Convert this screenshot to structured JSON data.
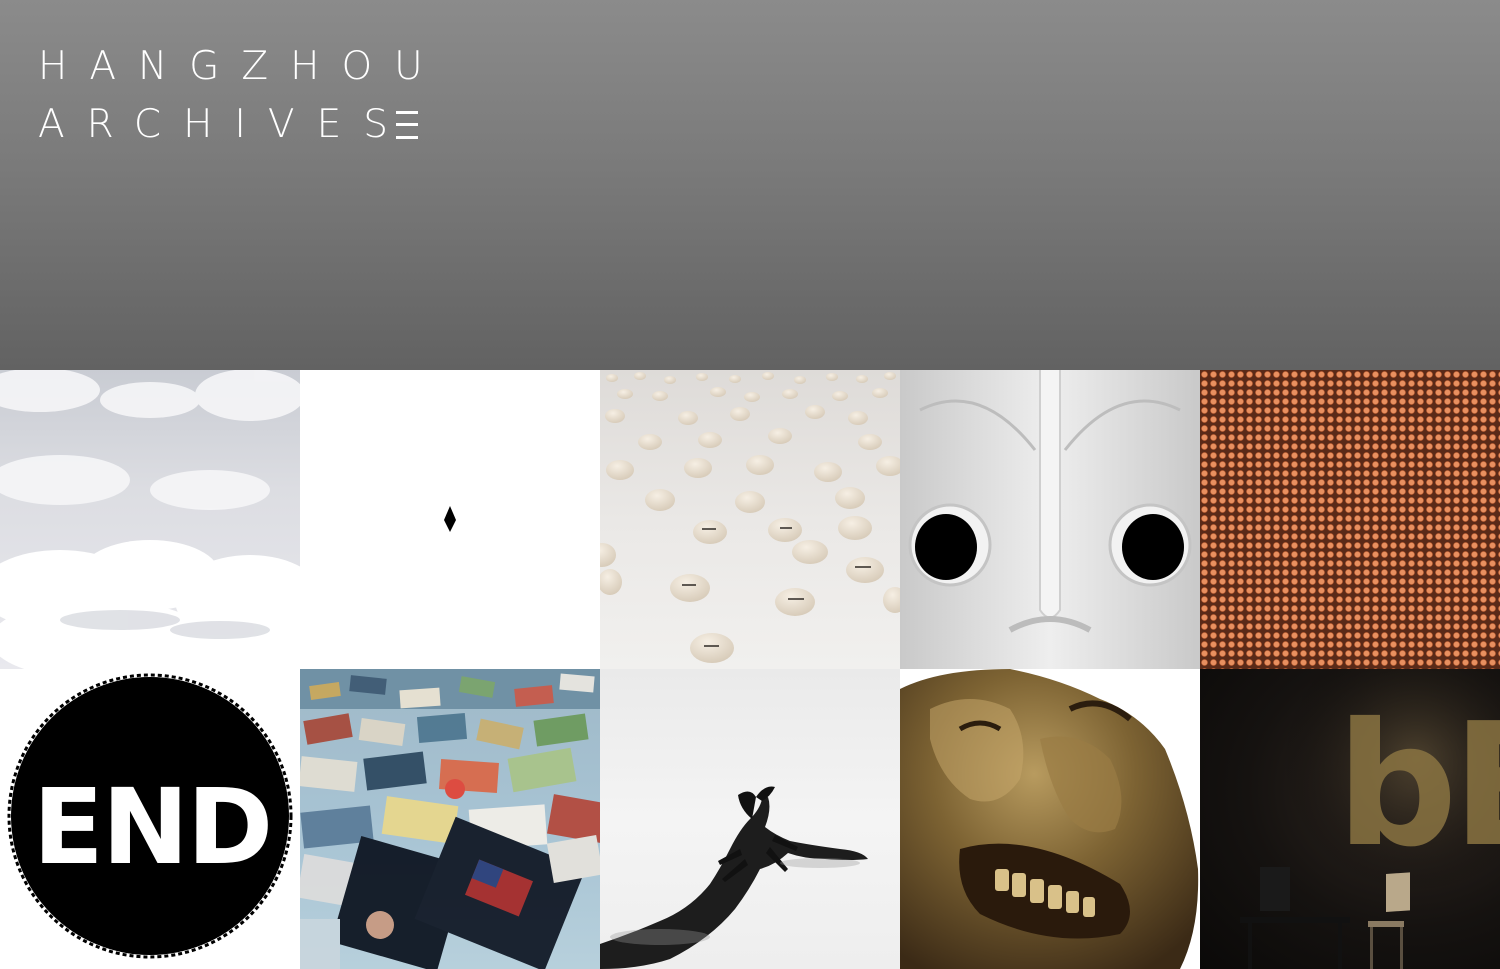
{
  "site": {
    "logo_line1": "HANGZHOU",
    "logo_line2": "ARCHIVES"
  },
  "colors": {
    "header_top": "#8b8b8b",
    "header_bottom": "#626262",
    "logo_text": "#ffffff"
  },
  "icons": {
    "menu": "menu-icon"
  },
  "gallery": {
    "tiles": [
      {
        "subject": "clouds"
      },
      {
        "subject": "black diamond on white"
      },
      {
        "subject": "field of eggshell domes"
      },
      {
        "subject": "white sculpted face"
      },
      {
        "subject": "copper dot pattern"
      },
      {
        "subject": "END brush circle",
        "text": "END"
      },
      {
        "subject": "scattered photographs"
      },
      {
        "subject": "black scorpion on white"
      },
      {
        "subject": "bronze grimacing face"
      },
      {
        "subject": "dark room with chair",
        "text": "bE"
      }
    ]
  }
}
